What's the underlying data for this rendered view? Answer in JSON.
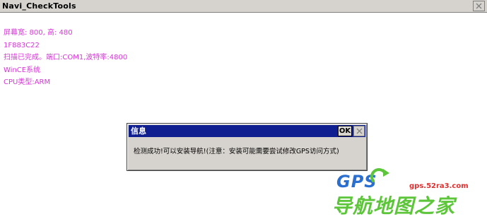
{
  "window": {
    "title": "Navi_CheckTools"
  },
  "info_lines": [
    "屏幕宽: 800, 高: 480",
    "1F883C22",
    "扫描已完成。端口:COM1,波特率:4800",
    "WinCE系统",
    "CPU类型:ARM"
  ],
  "dialog": {
    "title": "信息",
    "ok_label": "OK",
    "message": "检测成功!可以安装导航!(注意：安装可能需要尝试修改GPS访问方式)"
  },
  "watermark": {
    "logo_text": "GPS",
    "url": "gps.52ra3.com",
    "slogan": "导航地图之家"
  },
  "colors": {
    "info_text": "#d638d6",
    "dialog_title_bg": "#0f1f8f",
    "window_chrome": "#d6d3ce",
    "watermark_blue": "#2a6fd0",
    "watermark_green": "#5cc53a",
    "watermark_red": "#e03030"
  },
  "icons": {
    "window_close": "close-icon",
    "dialog_close": "close-icon",
    "watermark_arrow": "circular-arrow-icon"
  }
}
